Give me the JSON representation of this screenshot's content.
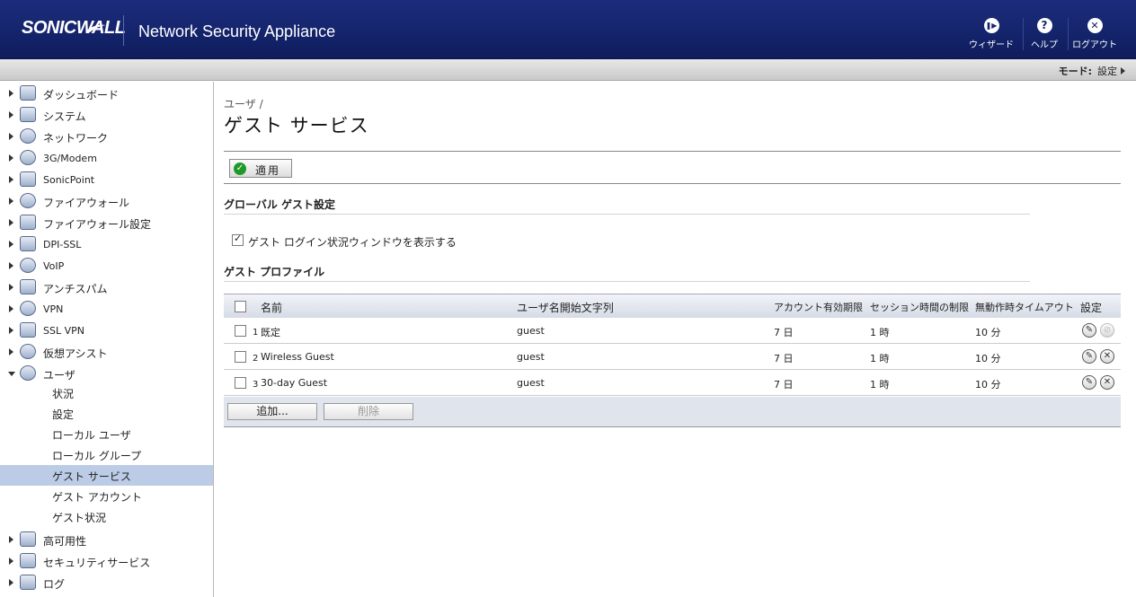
{
  "header": {
    "logo_text": "SONICWALL",
    "product": "Network Security Appliance",
    "buttons": [
      {
        "label": "ウィザード",
        "glyph": "❚▶"
      },
      {
        "label": "ヘルプ",
        "glyph": "?"
      },
      {
        "label": "ログアウト",
        "glyph": "✕"
      }
    ]
  },
  "modebar": {
    "label": "モード:",
    "value": "設定"
  },
  "sidebar": {
    "items": [
      {
        "label": "ダッシュボード",
        "icon": "dashboard-icon"
      },
      {
        "label": "システム",
        "icon": "system-icon"
      },
      {
        "label": "ネットワーク",
        "icon": "network-icon"
      },
      {
        "label": "3G/Modem",
        "icon": "modem-icon"
      },
      {
        "label": "SonicPoint",
        "icon": "sonicpoint-icon"
      },
      {
        "label": "ファイアウォール",
        "icon": "firewall-icon"
      },
      {
        "label": "ファイアウォール設定",
        "icon": "firewall-settings-icon"
      },
      {
        "label": "DPI-SSL",
        "icon": "dpi-ssl-icon"
      },
      {
        "label": "VoIP",
        "icon": "voip-icon"
      },
      {
        "label": "アンチスパム",
        "icon": "antispam-icon"
      },
      {
        "label": "VPN",
        "icon": "vpn-icon"
      },
      {
        "label": "SSL VPN",
        "icon": "ssl-vpn-icon"
      },
      {
        "label": "仮想アシスト",
        "icon": "virtual-assist-icon"
      },
      {
        "label": "ユーザ",
        "icon": "users-icon"
      }
    ],
    "sub_items": [
      {
        "label": "状況"
      },
      {
        "label": "設定"
      },
      {
        "label": "ローカル ユーザ"
      },
      {
        "label": "ローカル グループ"
      },
      {
        "label": "ゲスト サービス"
      },
      {
        "label": "ゲスト アカウント"
      },
      {
        "label": "ゲスト状況"
      }
    ],
    "bottom_items": [
      {
        "label": "高可用性",
        "icon": "high-availability-icon"
      },
      {
        "label": "セキュリティサービス",
        "icon": "security-services-icon"
      },
      {
        "label": "ログ",
        "icon": "log-icon"
      }
    ]
  },
  "main": {
    "breadcrumb": "ユーザ /",
    "title": "ゲスト サービス",
    "apply_label": "適用",
    "global_section": "グローバル ゲスト設定",
    "show_login_window_label": "ゲスト ログイン状況ウィンドウを表示する",
    "show_login_window_checked": true,
    "profile_section": "ゲスト プロファイル",
    "table": {
      "columns": [
        "名前",
        "ユーザ名開始文字列",
        "アカウント有効期限",
        "セッション時間の制限",
        "無動作時タイムアウト",
        "設定"
      ],
      "rows": [
        {
          "num": "1",
          "name": "既定",
          "prefix": "guest",
          "expiry": "7 日",
          "session": "1 時",
          "idle": "10 分"
        },
        {
          "num": "2",
          "name": "Wireless Guest",
          "prefix": "guest",
          "expiry": "7 日",
          "session": "1 時",
          "idle": "10 分"
        },
        {
          "num": "3",
          "name": "30-day Guest",
          "prefix": "guest",
          "expiry": "7 日",
          "session": "1 時",
          "idle": "10 分"
        }
      ],
      "add_label": "追加...",
      "delete_label": "削除"
    }
  }
}
